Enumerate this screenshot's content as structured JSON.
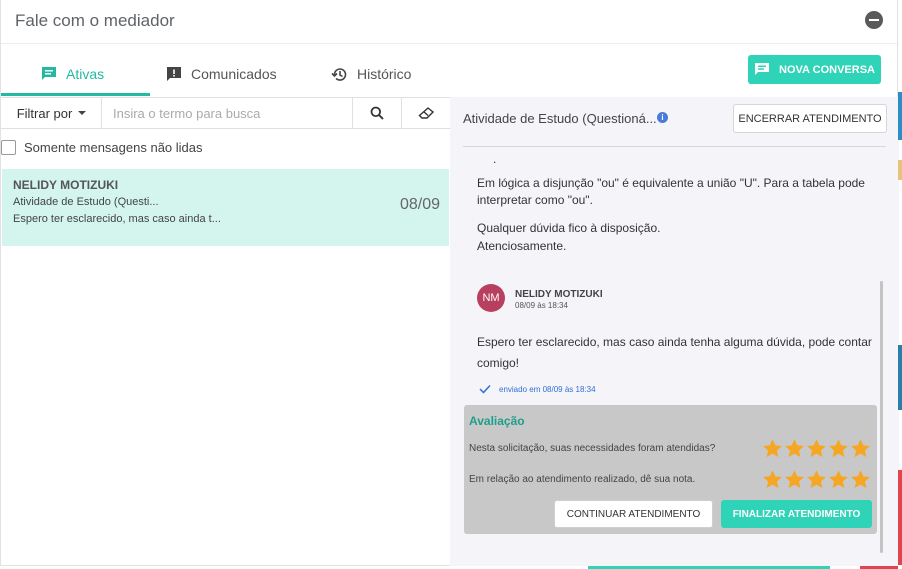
{
  "header": {
    "title": "Fale com o mediador",
    "minimize_icon": "minus-circle-icon"
  },
  "tabs": [
    {
      "label": "Ativas",
      "icon": "chat-icon",
      "active": true
    },
    {
      "label": "Comunicados",
      "icon": "announcement-icon",
      "active": false
    },
    {
      "label": "Histórico",
      "icon": "history-icon",
      "active": false
    }
  ],
  "new_conversation_button": "NOVA CONVERSA",
  "filter": {
    "label": "Filtrar por",
    "search_placeholder": "Insira o termo para busca"
  },
  "unread_only_label": "Somente mensagens não lidas",
  "conversations": [
    {
      "name": "NELIDY MOTIZUKI",
      "subject": "Atividade de Estudo (Questi...",
      "preview": "Espero ter esclarecido, mas caso ainda t...",
      "date": "08/09"
    }
  ],
  "conversation": {
    "title": "Atividade de Estudo (Questioná...",
    "info_icon": "info-icon",
    "close_button": "ENCERRAR ATENDIMENTO",
    "prev_message": {
      "dot": ".",
      "paragraph1": "Em lógica a disjunção \"ou\" é equivalente a união \"U\". Para a tabela pode interpretar como \"ou\".",
      "line1": "Qualquer dúvida fico à disposição.",
      "line2": "Atenciosamente."
    },
    "message": {
      "avatar_initials": "NM",
      "sender": "NELIDY MOTIZUKI",
      "timestamp": "08/09 às 18:34",
      "text": "Espero ter esclarecido, mas caso ainda tenha alguma dúvida, pode contar comigo!",
      "sent_status": "enviado em 08/09 às 18:34"
    },
    "rating": {
      "title": "Avaliação",
      "questions": [
        {
          "text": "Nesta solicitação, suas necessidades foram atendidas?",
          "stars": 5,
          "max": 5
        },
        {
          "text": "Em relação ao atendimento realizado, dê sua nota.",
          "stars": 5,
          "max": 5
        }
      ],
      "continue_button": "CONTINUAR ATENDIMENTO",
      "finish_button": "FINALIZAR ATENDIMENTO"
    }
  },
  "colors": {
    "accent": "#2fd3b8",
    "accent_dark": "#25b8a3",
    "selected_row": "#d3f5ed",
    "star": "#f5a623",
    "avatar": "#b8405e"
  }
}
